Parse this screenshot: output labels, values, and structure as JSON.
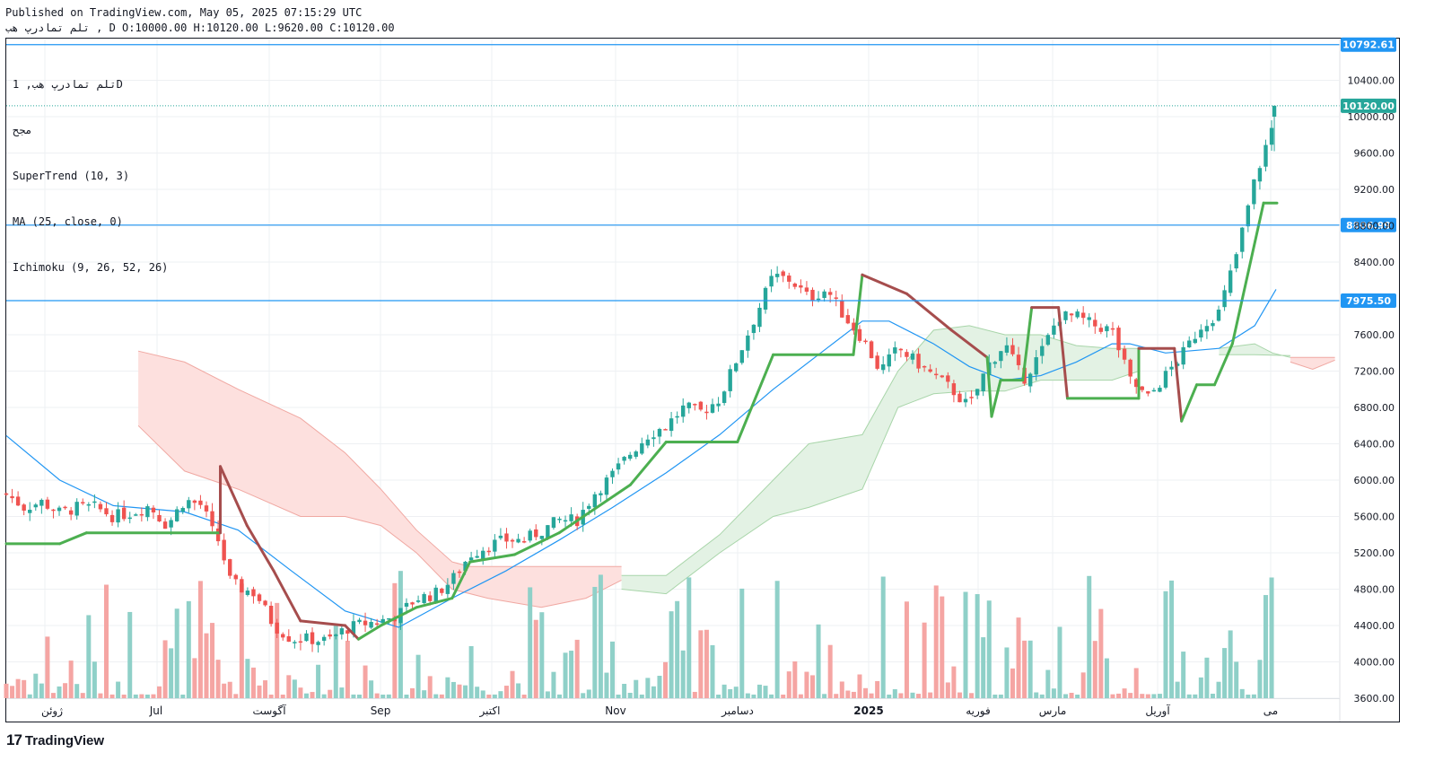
{
  "header": {
    "published": "Published on TradingView.com, May 05, 2025 07:15:29 UTC",
    "symbol": "تلم تمادرپ هب",
    "open": "D O:10000.00",
    "high": "H:10120.00",
    "low": "L:9620.00",
    "close": "C:10120.00"
  },
  "legend": {
    "symbol_interval": "تلم تمادرپ هب, 1D",
    "volume_label": "مجح",
    "supertrend": "SuperTrend (10, 3)",
    "ma": "MA (25, close, 0)",
    "ichimoku": "Ichimoku (9, 26, 52, 26)"
  },
  "brand": {
    "name": "TradingView",
    "logo": "tv-logo"
  },
  "colors": {
    "up": "#26a69a",
    "down": "#ef5350",
    "vol_up": "#8fd0c8",
    "vol_down": "#f5a5a3",
    "supertrend_up": "#4caf50",
    "supertrend_down": "#a64d4d",
    "ma": "#2196f3",
    "cloud_bull": "#e3f2e4",
    "cloud_bear": "#fde0de",
    "hline": "#2196f3",
    "price_tag": "#2196f3"
  },
  "chart_data": {
    "type": "candlestick",
    "y_axis": {
      "ticks": [
        "10400.00",
        "10000.00",
        "9600.00",
        "9200.00",
        "8800.00",
        "8400.00",
        "7600.00",
        "7200.00",
        "6800.00",
        "6400.00",
        "6000.00",
        "5600.00",
        "5200.00",
        "4800.00",
        "4400.00",
        "4000.00",
        "3600.00"
      ],
      "range": [
        3600,
        10900
      ]
    },
    "x_axis": {
      "ticks": [
        "ژوئن",
        "Jul",
        "آگوست",
        "Sep",
        "اکتبر",
        "Nov",
        "دسامبر",
        "2025",
        "فوریه",
        "مارس",
        "آوریل",
        "می"
      ]
    },
    "horizontal_lines": [
      {
        "value": 10792.61,
        "label": "10792.61"
      },
      {
        "value": 8806.99,
        "label": "8806.99"
      },
      {
        "value": 7975.5,
        "label": "7975.50"
      }
    ],
    "last_price": {
      "value": 10120.0,
      "label": "10120.00"
    },
    "series_close": [
      [
        0,
        5850
      ],
      [
        20,
        5700
      ],
      [
        40,
        5760
      ],
      [
        60,
        5640
      ],
      [
        80,
        5700
      ],
      [
        100,
        5700
      ],
      [
        120,
        5600
      ],
      [
        140,
        5640
      ],
      [
        160,
        5720
      ],
      [
        180,
        5500
      ],
      [
        200,
        5780
      ],
      [
        220,
        5720
      ],
      [
        230,
        5450
      ],
      [
        240,
        5300
      ],
      [
        250,
        4900
      ],
      [
        260,
        4820
      ],
      [
        280,
        4750
      ],
      [
        300,
        4400
      ],
      [
        320,
        4250
      ],
      [
        340,
        4250
      ],
      [
        360,
        4230
      ],
      [
        380,
        4360
      ],
      [
        400,
        4420
      ],
      [
        420,
        4450
      ],
      [
        440,
        4520
      ],
      [
        460,
        4700
      ],
      [
        480,
        4740
      ],
      [
        500,
        4900
      ],
      [
        520,
        5180
      ],
      [
        540,
        5280
      ],
      [
        560,
        5340
      ],
      [
        580,
        5340
      ],
      [
        600,
        5440
      ],
      [
        620,
        5560
      ],
      [
        640,
        5560
      ],
      [
        660,
        5860
      ],
      [
        680,
        6060
      ],
      [
        700,
        6300
      ],
      [
        720,
        6500
      ],
      [
        740,
        6600
      ],
      [
        760,
        6800
      ],
      [
        780,
        6750
      ],
      [
        800,
        6900
      ],
      [
        820,
        7350
      ],
      [
        840,
        7800
      ],
      [
        860,
        8250
      ],
      [
        880,
        8200
      ],
      [
        900,
        8000
      ],
      [
        920,
        8100
      ],
      [
        940,
        7800
      ],
      [
        960,
        7560
      ],
      [
        980,
        7200
      ],
      [
        1000,
        7450
      ],
      [
        1020,
        7300
      ],
      [
        1040,
        7150
      ],
      [
        1060,
        7000
      ],
      [
        1080,
        6800
      ],
      [
        1100,
        7250
      ],
      [
        1120,
        7500
      ],
      [
        1140,
        7100
      ],
      [
        1160,
        7400
      ],
      [
        1180,
        7800
      ],
      [
        1200,
        7800
      ],
      [
        1220,
        7700
      ],
      [
        1240,
        7650
      ],
      [
        1260,
        7100
      ],
      [
        1280,
        6900
      ],
      [
        1300,
        7150
      ],
      [
        1320,
        7400
      ],
      [
        1340,
        7700
      ],
      [
        1360,
        7850
      ],
      [
        1380,
        8500
      ],
      [
        1400,
        9300
      ],
      [
        1420,
        9900
      ],
      [
        1427,
        10120
      ]
    ],
    "supertrend": [
      [
        0,
        5300
      ],
      [
        60,
        5300
      ],
      [
        90,
        5420
      ],
      [
        240,
        5420
      ],
      [
        240,
        6150
      ],
      [
        270,
        5500
      ],
      [
        300,
        5000
      ],
      [
        330,
        4450
      ],
      [
        380,
        4400
      ],
      [
        395,
        4250
      ],
      [
        420,
        4400
      ],
      [
        460,
        4600
      ],
      [
        500,
        4700
      ],
      [
        520,
        5100
      ],
      [
        570,
        5180
      ],
      [
        620,
        5420
      ],
      [
        700,
        5950
      ],
      [
        740,
        6420
      ],
      [
        820,
        6420
      ],
      [
        860,
        7380
      ],
      [
        950,
        7380
      ],
      [
        960,
        8260
      ],
      [
        1010,
        8050
      ],
      [
        1060,
        7650
      ],
      [
        1100,
        7350
      ],
      [
        1105,
        6700
      ],
      [
        1115,
        7100
      ],
      [
        1140,
        7100
      ],
      [
        1150,
        7900
      ],
      [
        1180,
        7900
      ],
      [
        1190,
        6900
      ],
      [
        1270,
        6900
      ],
      [
        1270,
        7450
      ],
      [
        1310,
        7450
      ],
      [
        1318,
        6650
      ],
      [
        1335,
        7050
      ],
      [
        1355,
        7050
      ],
      [
        1375,
        7500
      ],
      [
        1410,
        9050
      ],
      [
        1425,
        9050
      ]
    ],
    "moving_average": [
      [
        0,
        6490
      ],
      [
        60,
        6000
      ],
      [
        120,
        5720
      ],
      [
        200,
        5650
      ],
      [
        260,
        5450
      ],
      [
        320,
        5000
      ],
      [
        380,
        4560
      ],
      [
        440,
        4380
      ],
      [
        500,
        4700
      ],
      [
        560,
        5000
      ],
      [
        620,
        5340
      ],
      [
        680,
        5700
      ],
      [
        740,
        6080
      ],
      [
        800,
        6500
      ],
      [
        860,
        7000
      ],
      [
        920,
        7450
      ],
      [
        960,
        7750
      ],
      [
        990,
        7750
      ],
      [
        1040,
        7500
      ],
      [
        1080,
        7250
      ],
      [
        1120,
        7100
      ],
      [
        1160,
        7150
      ],
      [
        1200,
        7300
      ],
      [
        1240,
        7500
      ],
      [
        1260,
        7500
      ],
      [
        1300,
        7400
      ],
      [
        1360,
        7450
      ],
      [
        1400,
        7700
      ],
      [
        1424,
        8100
      ]
    ],
    "ichimoku_cloud": {
      "bearish_top": [
        [
          148,
          7420
        ],
        [
          200,
          7300
        ],
        [
          260,
          7000
        ],
        [
          330,
          6680
        ],
        [
          380,
          6300
        ],
        [
          420,
          5900
        ],
        [
          460,
          5450
        ],
        [
          500,
          5100
        ],
        [
          520,
          5050
        ],
        [
          560,
          5050
        ],
        [
          620,
          5050
        ],
        [
          690,
          5050
        ]
      ],
      "bearish_bottom": [
        [
          148,
          6600
        ],
        [
          200,
          6100
        ],
        [
          260,
          5900
        ],
        [
          330,
          5600
        ],
        [
          380,
          5600
        ],
        [
          420,
          5500
        ],
        [
          460,
          5200
        ],
        [
          500,
          4800
        ],
        [
          540,
          4700
        ],
        [
          600,
          4600
        ],
        [
          650,
          4700
        ],
        [
          690,
          4900
        ]
      ],
      "bullish_top": [
        [
          690,
          4950
        ],
        [
          740,
          4950
        ],
        [
          800,
          5400
        ],
        [
          860,
          6000
        ],
        [
          900,
          6400
        ],
        [
          960,
          6500
        ],
        [
          1000,
          7200
        ],
        [
          1040,
          7650
        ],
        [
          1080,
          7700
        ],
        [
          1120,
          7600
        ],
        [
          1160,
          7600
        ],
        [
          1200,
          7480
        ],
        [
          1240,
          7450
        ],
        [
          1270,
          7450
        ]
      ],
      "bullish_bottom": [
        [
          690,
          4800
        ],
        [
          740,
          4750
        ],
        [
          800,
          5200
        ],
        [
          860,
          5600
        ],
        [
          900,
          5700
        ],
        [
          960,
          5900
        ],
        [
          1000,
          6800
        ],
        [
          1040,
          6950
        ],
        [
          1080,
          6980
        ],
        [
          1120,
          6980
        ],
        [
          1160,
          7100
        ],
        [
          1200,
          7100
        ],
        [
          1240,
          7100
        ],
        [
          1270,
          7200
        ]
      ],
      "late_bull_top": [
        [
          1360,
          7450
        ],
        [
          1400,
          7500
        ],
        [
          1420,
          7400
        ],
        [
          1440,
          7350
        ]
      ],
      "late_bull_bottom": [
        [
          1360,
          7380
        ],
        [
          1400,
          7380
        ],
        [
          1440,
          7370
        ]
      ],
      "late_bear_top": [
        [
          1440,
          7350
        ],
        [
          1490,
          7350
        ]
      ],
      "late_bear_bottom": [
        [
          1440,
          7300
        ],
        [
          1465,
          7220
        ],
        [
          1490,
          7320
        ]
      ]
    }
  }
}
